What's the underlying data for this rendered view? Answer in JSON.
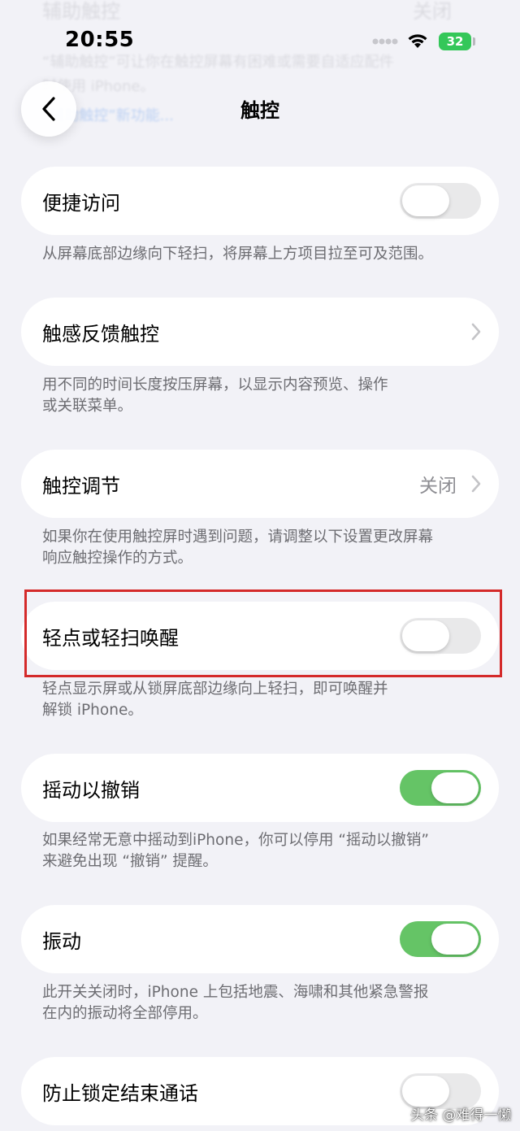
{
  "ghost": {
    "title": "辅助触控",
    "value": "关闭",
    "line1": "“辅助触控”可让你在触控屏幕有困难或需要自适应配件",
    "line2": "时使用 iPhone。",
    "link": "“辅助触控”新功能..."
  },
  "status_bar": {
    "time": "20:55",
    "battery": "32"
  },
  "nav": {
    "back_icon": "chevron-left-icon",
    "title": "触控"
  },
  "settings": [
    {
      "label": "便捷访问",
      "control": "toggle",
      "on": false,
      "footer": [
        "从屏幕底部边缘向下轻扫，将屏幕上方项目拉至可及范围。"
      ]
    },
    {
      "label": "触感反馈触控",
      "control": "chevron",
      "footer": [
        "用不同的时间长度按压屏幕，以显示内容预览、操作",
        "或关联菜单。"
      ]
    },
    {
      "label": "触控调节",
      "control": "chevron",
      "value": "关闭",
      "footer": [
        "如果你在使用触控屏时遇到问题，请调整以下设置更改屏幕",
        "响应触控操作的方式。"
      ]
    },
    {
      "label": "轻点或轻扫唤醒",
      "control": "toggle",
      "on": false,
      "footer": [
        "轻点显示屏或从锁屏底部边缘向上轻扫，即可唤醒并",
        "解锁 iPhone。"
      ]
    },
    {
      "label": "摇动以撤销",
      "control": "toggle",
      "on": true,
      "footer": [
        "如果经常无意中摇动到iPhone，你可以停用 “摇动以撤销”",
        "来避免出现 “撤销” 提醒。"
      ]
    },
    {
      "label": "振动",
      "control": "toggle",
      "on": true,
      "footer": [
        "此开关关闭时，iPhone 上包括地震、海啸和其他紧急警报",
        "在内的振动将全部停用。"
      ]
    },
    {
      "label": "防止锁定结束通话",
      "control": "toggle",
      "on": false
    }
  ],
  "colors": {
    "background": "#f2f2f7",
    "toggle_on": "#65c466",
    "toggle_off": "#e9e9ea",
    "highlight": "#d42a2a"
  },
  "watermark": "头条 @难得一懒"
}
